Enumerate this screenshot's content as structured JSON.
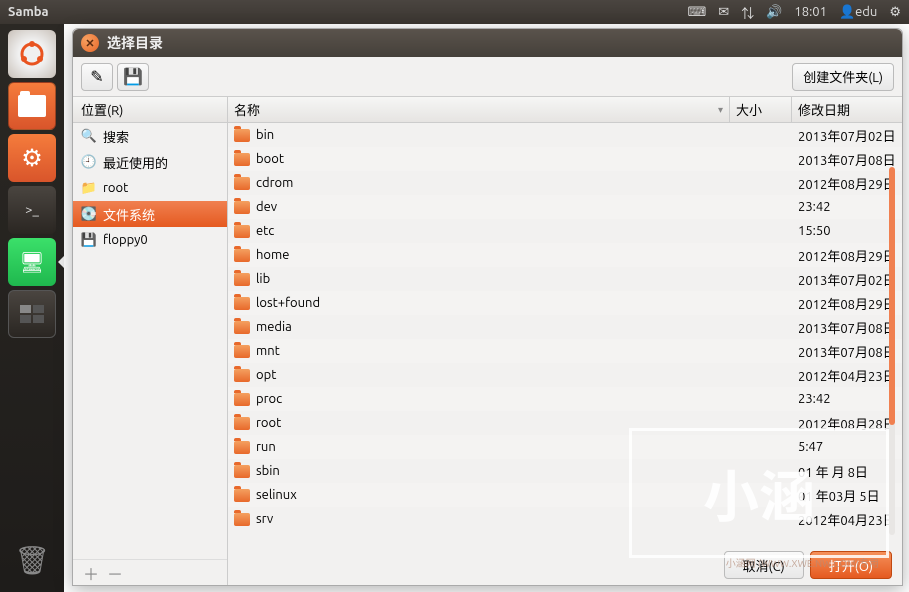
{
  "menubar": {
    "title": "Samba",
    "time": "18:01",
    "user": "edu"
  },
  "dialog": {
    "title": "选择目录",
    "new_folder": "创建文件夹(L)",
    "cancel": "取消(C)",
    "open": "打开(O)"
  },
  "sidebar": {
    "header": "位置(R)",
    "items": [
      {
        "icon": "search",
        "label": "搜索"
      },
      {
        "icon": "recent",
        "label": "最近使用的"
      },
      {
        "icon": "folder",
        "label": "root"
      },
      {
        "icon": "disk",
        "label": "文件系统",
        "selected": true
      },
      {
        "icon": "floppy",
        "label": "floppy0"
      }
    ]
  },
  "columns": {
    "name": "名称",
    "size": "大小",
    "date": "修改日期"
  },
  "files": [
    {
      "name": "bin",
      "size": "",
      "date": "2013年07月02日"
    },
    {
      "name": "boot",
      "size": "",
      "date": "2013年07月08日"
    },
    {
      "name": "cdrom",
      "size": "",
      "date": "2012年08月29日"
    },
    {
      "name": "dev",
      "size": "",
      "date": "23:42"
    },
    {
      "name": "etc",
      "size": "",
      "date": "15:50"
    },
    {
      "name": "home",
      "size": "",
      "date": "2012年08月29日"
    },
    {
      "name": "lib",
      "size": "",
      "date": "2013年07月02日"
    },
    {
      "name": "lost+found",
      "size": "",
      "date": "2012年08月29日"
    },
    {
      "name": "media",
      "size": "",
      "date": "2013年07月08日"
    },
    {
      "name": "mnt",
      "size": "",
      "date": "2013年07月08日"
    },
    {
      "name": "opt",
      "size": "",
      "date": "2012年04月23日"
    },
    {
      "name": "proc",
      "size": "",
      "date": "23:42"
    },
    {
      "name": "root",
      "size": "",
      "date": "2012年08月28日"
    },
    {
      "name": "run",
      "size": "",
      "date": "5:47"
    },
    {
      "name": "sbin",
      "size": "",
      "date": "01 年 月 8日"
    },
    {
      "name": "selinux",
      "size": "",
      "date": "01 年03月 5日"
    },
    {
      "name": "srv",
      "size": "",
      "date": "2012年04月23日"
    }
  ],
  "watermark": {
    "text": "小涵",
    "sub": "小涵网 (WWW.XWE.NW.COM)专用"
  }
}
